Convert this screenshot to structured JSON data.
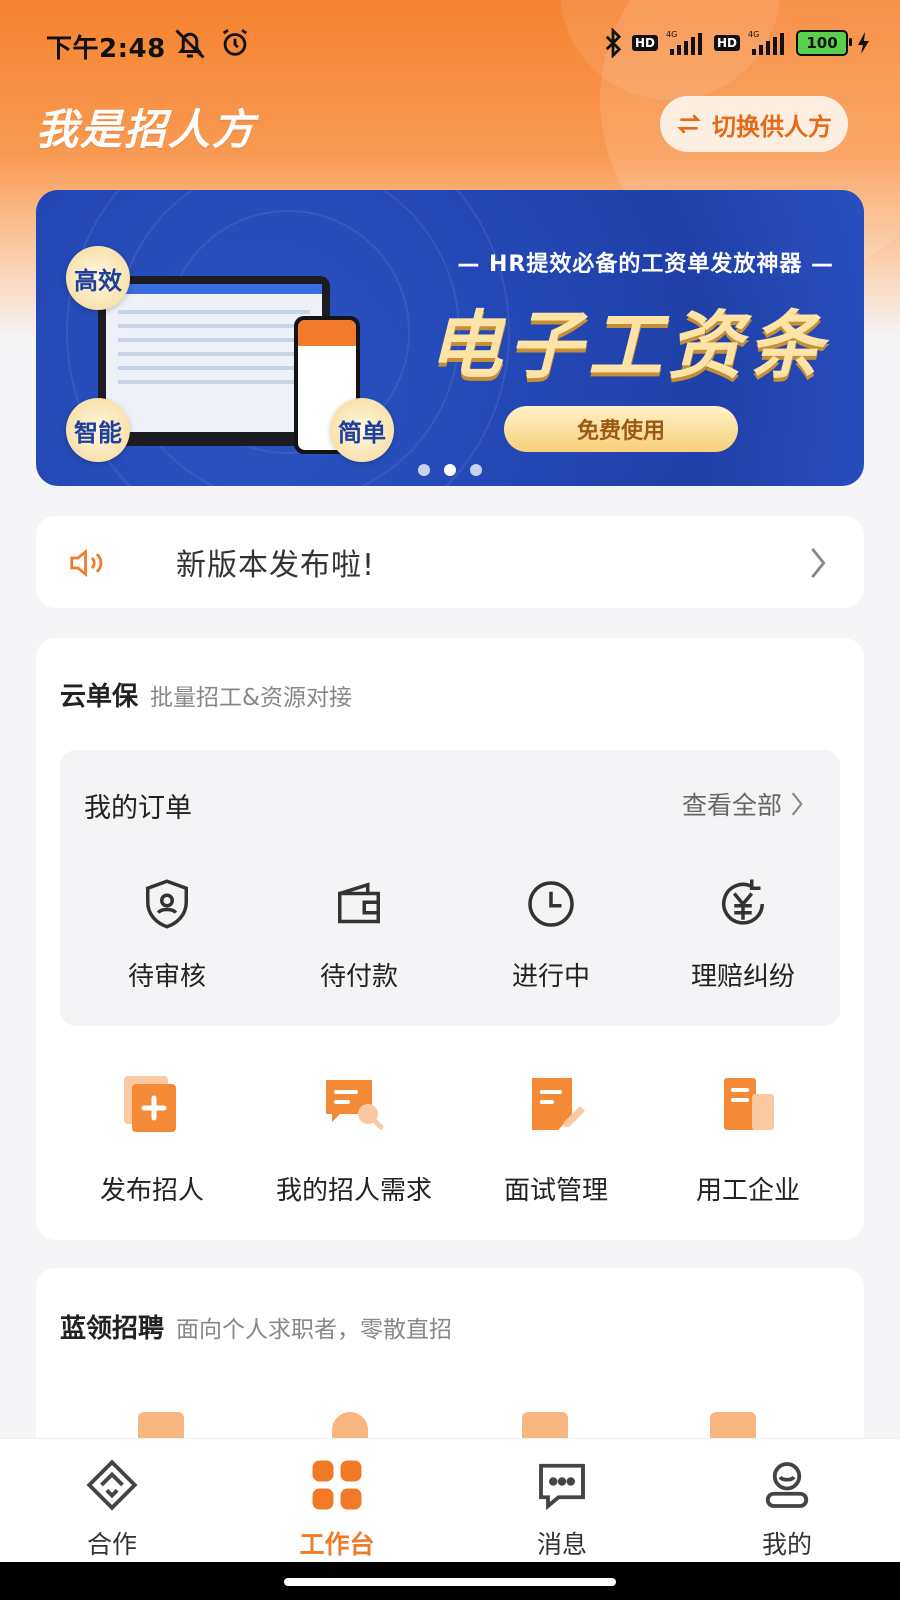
{
  "status_bar": {
    "time": "下午2:48",
    "battery": "100",
    "network": "4G"
  },
  "header": {
    "title": "我是招人方",
    "switch_label": "切换供人方"
  },
  "banner": {
    "subtitle": "— HR提效必备的工资单发放神器 —",
    "headline": "电子工资条",
    "cta": "免费使用",
    "badges": [
      "高效",
      "智能",
      "简单"
    ],
    "slides": 3,
    "active_slide": 1
  },
  "notice": {
    "text": "新版本发布啦!"
  },
  "cloud_card": {
    "title": "云单保",
    "subtitle": "批量招工&资源对接",
    "orders": {
      "title": "我的订单",
      "view_all": "查看全部",
      "items": [
        {
          "label": "待审核",
          "icon": "shield-user-icon"
        },
        {
          "label": "待付款",
          "icon": "wallet-icon"
        },
        {
          "label": "进行中",
          "icon": "clock-icon"
        },
        {
          "label": "理赔纠纷",
          "icon": "yuan-refresh-icon"
        }
      ]
    },
    "features": [
      {
        "label": "发布招人",
        "icon": "publish-plus-icon"
      },
      {
        "label": "我的招人需求",
        "icon": "chat-search-icon"
      },
      {
        "label": "面试管理",
        "icon": "note-edit-icon"
      },
      {
        "label": "用工企业",
        "icon": "building-icon"
      }
    ]
  },
  "blue_card": {
    "title": "蓝领招聘",
    "subtitle": "面向个人求职者，零散直招"
  },
  "bottom_nav": [
    {
      "label": "合作",
      "icon": "handshake-icon",
      "active": false
    },
    {
      "label": "工作台",
      "icon": "grid-icon",
      "active": true
    },
    {
      "label": "消息",
      "icon": "message-icon",
      "active": false
    },
    {
      "label": "我的",
      "icon": "profile-icon",
      "active": false
    }
  ],
  "colors": {
    "accent": "#f07a26",
    "banner_blue": "#2348b6"
  }
}
